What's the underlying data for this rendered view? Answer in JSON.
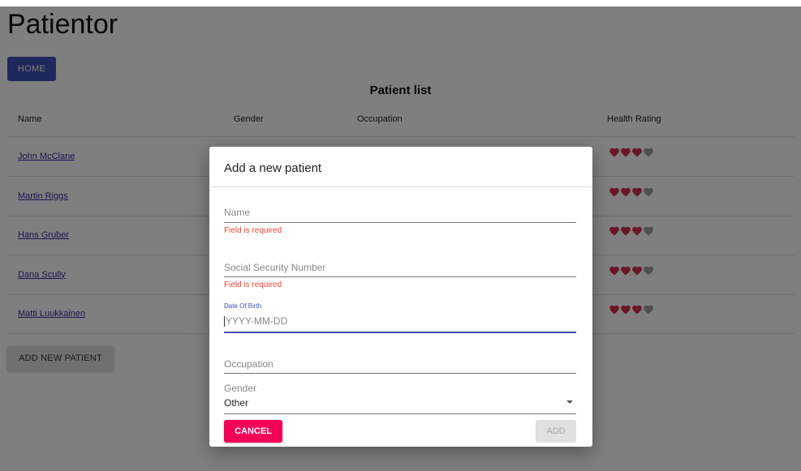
{
  "app": {
    "title": "Patientor",
    "home_label": "HOME"
  },
  "patient_list": {
    "title": "Patient list",
    "columns": [
      "Name",
      "Gender",
      "Occupation",
      "Health Rating"
    ],
    "rows": [
      {
        "name": "John McClane",
        "health_rating": 3,
        "max_rating": 4
      },
      {
        "name": "Martin Riggs",
        "health_rating": 3,
        "max_rating": 4
      },
      {
        "name": "Hans Gruber",
        "health_rating": 3,
        "max_rating": 4
      },
      {
        "name": "Dana Scully",
        "health_rating": 3,
        "max_rating": 4
      },
      {
        "name": "Matti Luukkainen",
        "health_rating": 3,
        "max_rating": 4
      }
    ],
    "add_button_label": "ADD NEW PATIENT"
  },
  "modal": {
    "title": "Add a new patient",
    "fields": {
      "name": {
        "placeholder": "Name",
        "error": "Field is required"
      },
      "ssn": {
        "placeholder": "Social Security Number",
        "error": "Field is required"
      },
      "date_of_birth": {
        "label": "Date Of Birth",
        "placeholder": "YYYY-MM-DD"
      },
      "occupation": {
        "placeholder": "Occupation"
      },
      "gender": {
        "label": "Gender",
        "value": "Other"
      }
    },
    "cancel_label": "CANCEL",
    "add_label": "ADD"
  },
  "colors": {
    "primary": "#3f51b5",
    "secondary": "#f50057",
    "error": "#f44336",
    "heart_filled": "#d32f4f",
    "heart_empty": "#9e9e9e"
  },
  "icons": {
    "heart": "heart-icon",
    "dropdown": "arrow-drop-down-icon"
  }
}
